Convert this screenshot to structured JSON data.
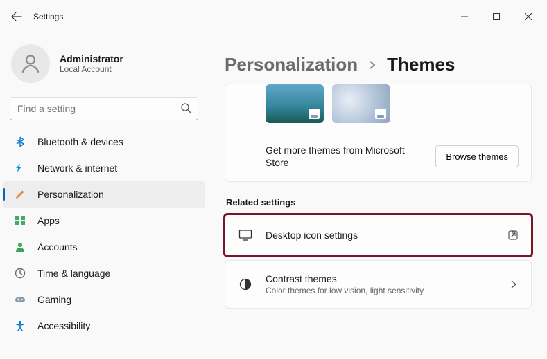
{
  "app": {
    "title": "Settings"
  },
  "user": {
    "name": "Administrator",
    "sub": "Local Account"
  },
  "search": {
    "placeholder": "Find a setting"
  },
  "nav": {
    "items": [
      {
        "label": "Bluetooth & devices"
      },
      {
        "label": "Network & internet"
      },
      {
        "label": "Personalization"
      },
      {
        "label": "Apps"
      },
      {
        "label": "Accounts"
      },
      {
        "label": "Time & language"
      },
      {
        "label": "Gaming"
      },
      {
        "label": "Accessibility"
      }
    ]
  },
  "breadcrumb": {
    "parent": "Personalization",
    "current": "Themes"
  },
  "themes": {
    "store_text": "Get more themes from Microsoft Store",
    "browse_label": "Browse themes"
  },
  "related": {
    "header": "Related settings",
    "items": [
      {
        "title": "Desktop icon settings",
        "sub": ""
      },
      {
        "title": "Contrast themes",
        "sub": "Color themes for low vision, light sensitivity"
      }
    ]
  }
}
